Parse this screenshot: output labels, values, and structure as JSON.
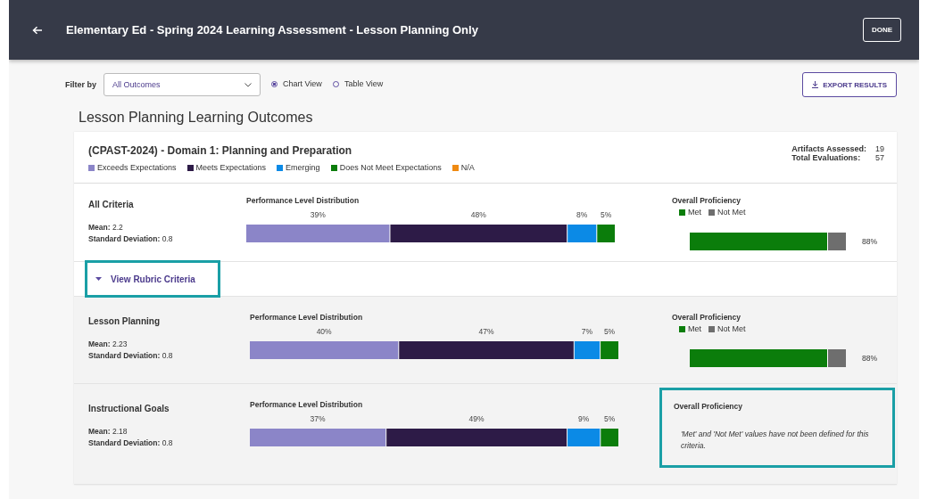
{
  "header": {
    "title": "Elementary Ed - Spring 2024 Learning Assessment - Lesson Planning Only",
    "done_button": "DONE"
  },
  "toolbar": {
    "filter_label": "Filter by",
    "filter": {
      "value": "All Outcomes"
    },
    "views": [
      {
        "label": "Chart View",
        "selected": true
      },
      {
        "label": "Table View",
        "selected": false
      }
    ],
    "export_button": "EXPORT RESULTS"
  },
  "page_title": "Lesson Planning Learning Outcomes",
  "domain": {
    "title": "(CPAST-2024) - Domain 1: Planning and Preparation",
    "legend": [
      {
        "label": "Exceeds Expectations",
        "color": "#8b85c8"
      },
      {
        "label": "Meets Expectations",
        "color": "#2d1b47"
      },
      {
        "label": "Emerging",
        "color": "#0b8ae6"
      },
      {
        "label": "Does Not Meet Expectations",
        "color": "#0b7d0b"
      },
      {
        "label": "N/A",
        "color": "#ef8a12"
      }
    ],
    "stats": [
      {
        "label": "Artifacts Assessed:",
        "value": "19"
      },
      {
        "label": "Total Evaluations:",
        "value": "57"
      }
    ]
  },
  "summary": {
    "name": "All Criteria",
    "mean": "**Mean:** 2.2",
    "sd": "**Standard Deviation:** 0.8",
    "distribution": {
      "title": "Performance Level Distribution",
      "segments": [
        {
          "label": "39%",
          "color": "#8b85c8"
        },
        {
          "label": "48%",
          "color": "#2d1b47"
        },
        {
          "label": "8%",
          "color": "#0b8ae6"
        },
        {
          "label": "5%",
          "color": "#0b7d0b"
        }
      ]
    },
    "proficiency": {
      "title": "Overall Proficiency",
      "kind": "bar",
      "highlighted": false,
      "legend": [
        {
          "label": "Met",
          "color": "#0b7d0b"
        },
        {
          "label": "Not Met",
          "color": "#6e6e6e"
        }
      ],
      "level": 0.88,
      "reading": "88%"
    }
  },
  "toggle": {
    "label": "View Rubric Criteria",
    "expanded": true,
    "highlighted": true
  },
  "criteria": [
    {
      "name": "Lesson Planning",
      "mean": "**Mean:** 2.23",
      "sd": "**Standard Deviation:** 0.8",
      "distribution": {
        "title": "Performance Level Distribution",
        "segments": [
          {
            "label": "40%",
            "color": "#8b85c8"
          },
          {
            "label": "47%",
            "color": "#2d1b47"
          },
          {
            "label": "7%",
            "color": "#0b8ae6"
          },
          {
            "label": "5%",
            "color": "#0b7d0b"
          }
        ]
      },
      "proficiency": {
        "title": "Overall Proficiency",
        "kind": "bar",
        "highlighted": false,
        "legend": [
          {
            "label": "Met",
            "color": "#0b7d0b"
          },
          {
            "label": "Not Met",
            "color": "#6e6e6e"
          }
        ],
        "level": 0.88,
        "reading": "88%"
      }
    },
    {
      "name": "Instructional Goals",
      "mean": "**Mean:** 2.18",
      "sd": "**Standard Deviation:** 0.8",
      "distribution": {
        "title": "Performance Level Distribution",
        "segments": [
          {
            "label": "37%",
            "color": "#8b85c8"
          },
          {
            "label": "49%",
            "color": "#2d1b47"
          },
          {
            "label": "9%",
            "color": "#0b8ae6"
          },
          {
            "label": "5%",
            "color": "#0b7d0b"
          }
        ]
      },
      "proficiency": {
        "title": "Overall Proficiency",
        "kind": "note",
        "highlighted": true,
        "note": "'Met' and 'Not Met' values have not been defined for this criteria."
      }
    }
  ]
}
